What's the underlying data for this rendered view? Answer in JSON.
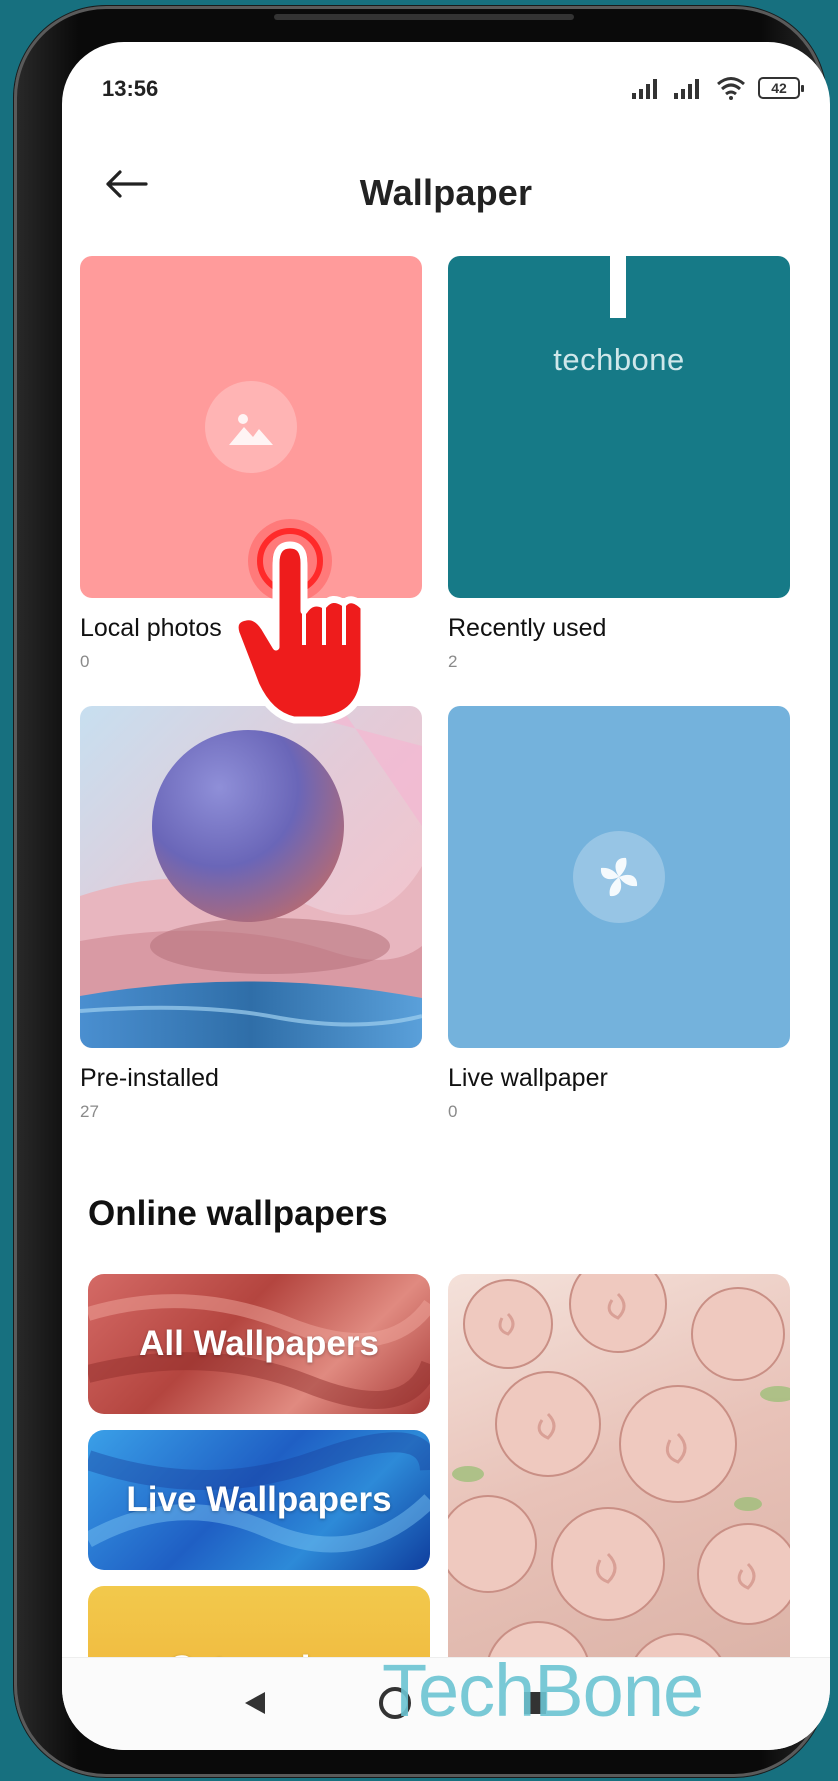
{
  "status_bar": {
    "time": "13:56",
    "battery": "42"
  },
  "header": {
    "title": "Wallpaper"
  },
  "tiles": [
    {
      "label": "Local photos",
      "count": "0",
      "color": "#ff9b9b"
    },
    {
      "label": "Recently used",
      "count": "2",
      "color": "#167a87",
      "thumb_text": "techbone"
    },
    {
      "label": "Pre-installed",
      "count": "27"
    },
    {
      "label": "Live wallpaper",
      "count": "0",
      "color": "#74b2dc"
    }
  ],
  "online": {
    "title": "Online wallpapers",
    "cards": [
      "All Wallpapers",
      "Live Wallpapers",
      "Categories"
    ]
  },
  "watermark": "TechBone"
}
